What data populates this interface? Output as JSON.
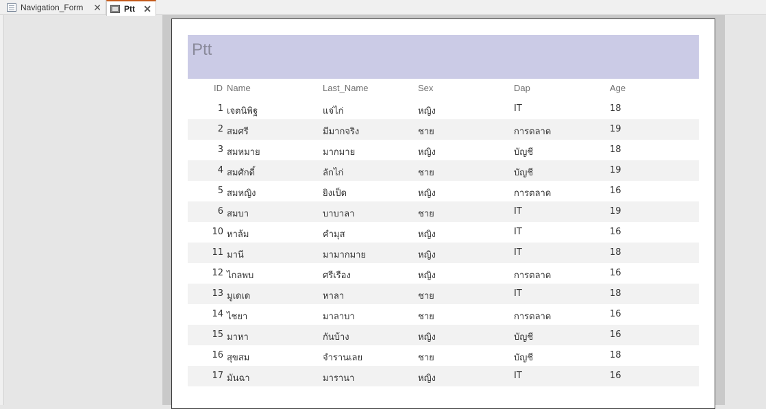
{
  "tabs": [
    {
      "label": "Navigation_Form",
      "icon": "form-icon"
    },
    {
      "label": "Ptt",
      "icon": "report-icon"
    }
  ],
  "report": {
    "title": "Ptt",
    "columns": [
      "ID",
      "Name",
      "Last_Name",
      "Sex",
      "Dap",
      "Age"
    ],
    "rows": [
      [
        "1",
        "เจตนิพิฐ",
        "แจ่ไก่",
        "หญิง",
        "IT",
        "18"
      ],
      [
        "2",
        "สมศรี",
        "มีมากจริง",
        "ชาย",
        "การตลาด",
        "19"
      ],
      [
        "3",
        "สมหมาย",
        "มากมาย",
        "หญิง",
        "บัญชี",
        "18"
      ],
      [
        "4",
        "สมศักดิ์",
        "ลักไก่",
        "ชาย",
        "บัญชี",
        "19"
      ],
      [
        "5",
        "สมหญิง",
        "ยิงเป็ด",
        "หญิง",
        "การตลาด",
        "16"
      ],
      [
        "6",
        "สมบา",
        "บาบาลา",
        "ชาย",
        "IT",
        "19"
      ],
      [
        "10",
        "หาล้ม",
        "คำมุส",
        "หญิง",
        "IT",
        "16"
      ],
      [
        "11",
        "มานี",
        "มามากมาย",
        "หญิง",
        "IT",
        "18"
      ],
      [
        "12",
        "ไกลพบ",
        "ศรีเรือง",
        "หญิง",
        "การตลาด",
        "16"
      ],
      [
        "13",
        "มูเดเด",
        "หาลา",
        "ชาย",
        "IT",
        "18"
      ],
      [
        "14",
        "ไชยา",
        "มาลาบา",
        "ชาย",
        "การตลาด",
        "16"
      ],
      [
        "15",
        "มาหา",
        "กันบ้าง",
        "หญิง",
        "บัญชี",
        "16"
      ],
      [
        "16",
        "สุขสม",
        "จำรานเลย",
        "ชาย",
        "บัญชี",
        "18"
      ],
      [
        "17",
        "มันฉา",
        "มารานา",
        "หญิง",
        "IT",
        "16"
      ]
    ]
  }
}
